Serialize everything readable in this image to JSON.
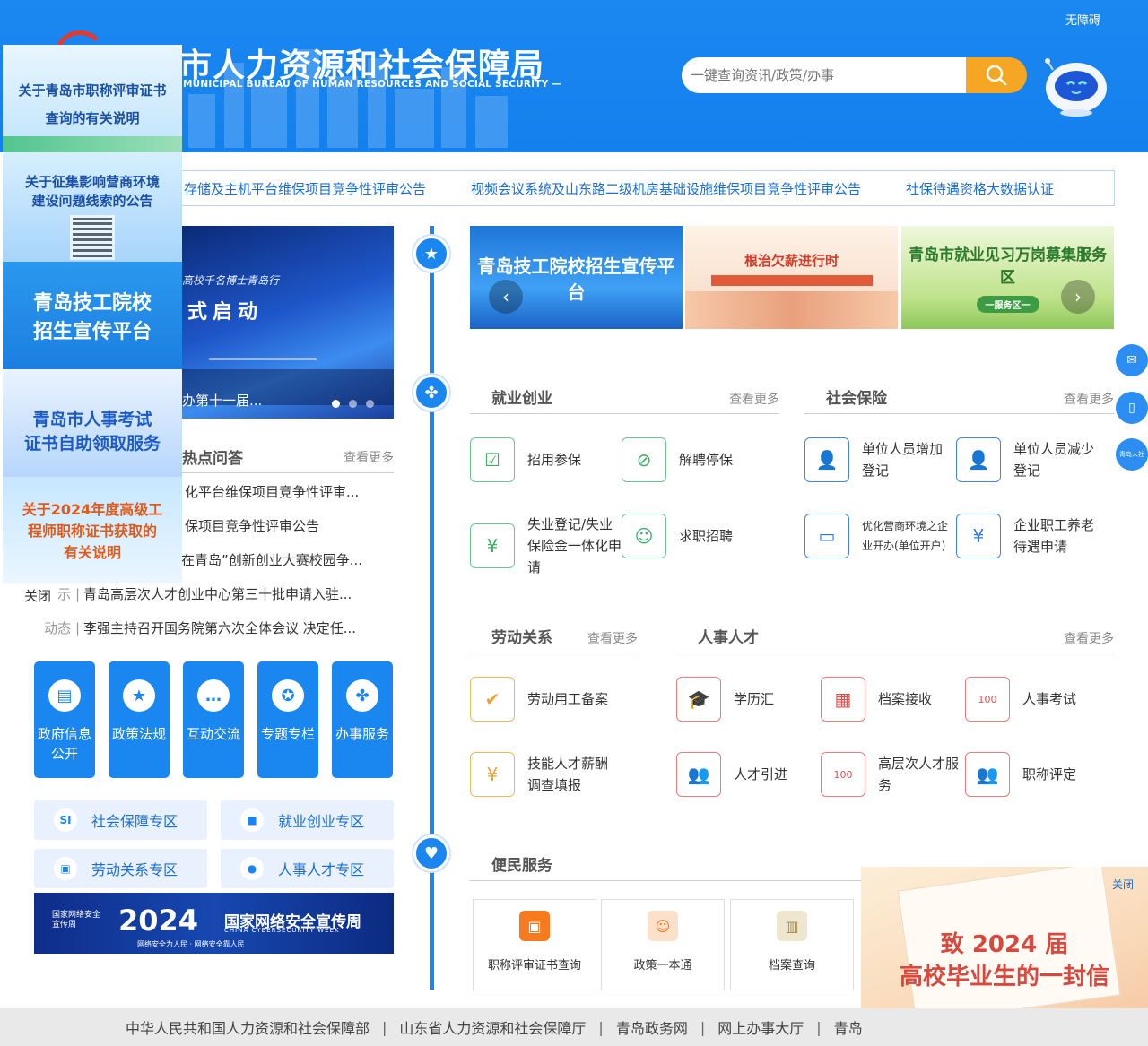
{
  "header": {
    "title": "青岛市人力资源和社会保障局",
    "title_visible": "市人力资源和社会保障局",
    "subtitle": "MUNICIPAL BUREAU OF HUMAN RESOURCES AND SOCIAL SECURITY —",
    "accessible_label": "无障碍",
    "search_placeholder": "一键查询资讯/政策/办事"
  },
  "ticker": [
    "存储及主机平台维保项目竞争性评审公告",
    "视频会议系统及山东路二级机房基础设施维保项目竞争性评审公告",
    "社保待遇资格大数据认证"
  ],
  "left_ads": [
    {
      "text_1": "关于青岛市职称评审证书",
      "text_2": "查询的有关说明"
    },
    {
      "text_1": "关于征集影响营商环境",
      "text_2": "建设问题线索的公告"
    },
    {
      "text_1": "青岛技工院校",
      "text_2": "招生宣传平台"
    },
    {
      "text_1": "青岛市人事考试",
      "text_2": "证书自助领取服务"
    },
    {
      "text_1": "关于2024年度高级工",
      "text_2": "程师职称证书获取的",
      "text_3": "有关说明"
    }
  ],
  "close_ad_label": "关闭",
  "main_image": {
    "caption": "办第十一届...",
    "banner_line1": "高校千名博士青岛行",
    "banner_line2": "式启动"
  },
  "hot": {
    "title": "热点问答",
    "more": "查看更多",
    "rows": [
      {
        "tag": "",
        "text": "化平台维保项目竞争性评审..."
      },
      {
        "tag": "",
        "text": "保项目竞争性评审公告"
      },
      {
        "tag": "",
        "text": "在青岛”创新创业大赛校园争..."
      },
      {
        "tag": "示 |",
        "text": "青岛高层次人才创业中心第三十批申请入驻..."
      },
      {
        "tag": "动态 |",
        "text": "李强主持召开国务院第六次全体会议 决定任..."
      }
    ]
  },
  "big_buttons": [
    {
      "label": "政府信息公开",
      "icon": "document-icon"
    },
    {
      "label": "政策法规",
      "icon": "bookmark-icon"
    },
    {
      "label": "互动交流",
      "icon": "chat-icon"
    },
    {
      "label": "专题专栏",
      "icon": "star-icon"
    },
    {
      "label": "办事服务",
      "icon": "grid-icon"
    }
  ],
  "zones": [
    {
      "label": "社会保障专区",
      "icon": "si-icon"
    },
    {
      "label": "就业创业专区",
      "icon": "briefcase-icon"
    },
    {
      "label": "劳动关系专区",
      "icon": "badge-icon"
    },
    {
      "label": "人事人才专区",
      "icon": "person-icon"
    }
  ],
  "cyber_banner": {
    "org": "国家网络安全宣传周",
    "year": "2024",
    "title": "国家网络安全宣传周",
    "english": "CHINA  CYBERSECURITY  WEEK",
    "slogan": "网络安全为人民 · 网络安全靠人民"
  },
  "right_banners": [
    {
      "text": "青岛技工院校招生宣传平台"
    },
    {
      "text": "根治欠薪进行时"
    },
    {
      "text": "青岛市就业见习万岗募集服务区",
      "sub": "一服务区一"
    }
  ],
  "employment": {
    "title": "就业创业",
    "more": "查看更多",
    "items": [
      {
        "label": "招用参保",
        "icon": "form-icon"
      },
      {
        "label": "解聘停保",
        "icon": "unlink-icon"
      },
      {
        "label": "失业登记/失业保险金一体化申请",
        "icon": "yuan-hand-icon"
      },
      {
        "label": "求职招聘",
        "icon": "person-search-icon"
      }
    ]
  },
  "social_insurance": {
    "title": "社会保险",
    "more": "查看更多",
    "items": [
      {
        "label": "单位人员增加登记",
        "icon": "user-add-icon"
      },
      {
        "label": "单位人员减少登记",
        "icon": "user-remove-icon"
      },
      {
        "label": "优化营商环境之企业开办(单位开户)",
        "icon": "ticket-icon"
      },
      {
        "label": "企业职工养老待遇申请",
        "icon": "money-bag-icon"
      }
    ]
  },
  "labor": {
    "title": "劳动关系",
    "more": "查看更多",
    "items": [
      {
        "label": "劳动用工备案",
        "icon": "shield-check-icon"
      },
      {
        "label": "技能人才薪酬调查填报",
        "icon": "box-yuan-icon"
      }
    ]
  },
  "talent": {
    "title": "人事人才",
    "more": "查看更多",
    "items": [
      {
        "label": "学历汇",
        "icon": "graduation-icon"
      },
      {
        "label": "档案接收",
        "icon": "file-box-icon"
      },
      {
        "label": "人事考试",
        "icon": "exam-icon"
      },
      {
        "label": "人才引进",
        "icon": "people-icon"
      },
      {
        "label": "高层次人才服务",
        "icon": "exam-icon"
      },
      {
        "label": "职称评定",
        "icon": "people-icon"
      }
    ]
  },
  "convenience": {
    "title": "便民服务",
    "items": [
      {
        "label": "职称评审证书查询",
        "icon": "certificate-icon"
      },
      {
        "label": "政策一本通",
        "icon": "policy-icon"
      },
      {
        "label": "档案查询",
        "icon": "archive-icon"
      }
    ]
  },
  "popup": {
    "line1": "致 2024 届",
    "line2": "高校毕业生的一封信",
    "close": "关闭"
  },
  "side_float": [
    {
      "icon": "wechat-icon",
      "label": ""
    },
    {
      "icon": "mobile-icon",
      "label": ""
    },
    {
      "icon": "app-icon",
      "label": "青岛人社"
    }
  ],
  "footer": [
    "中华人民共和国人力资源和社会保障部",
    "山东省人力资源和社会保障厅",
    "青岛政务网",
    "网上办事大厅",
    "青岛"
  ],
  "colors": {
    "primary": "#1a86f0",
    "accent": "#f5a623",
    "link": "#1a6ed8"
  }
}
